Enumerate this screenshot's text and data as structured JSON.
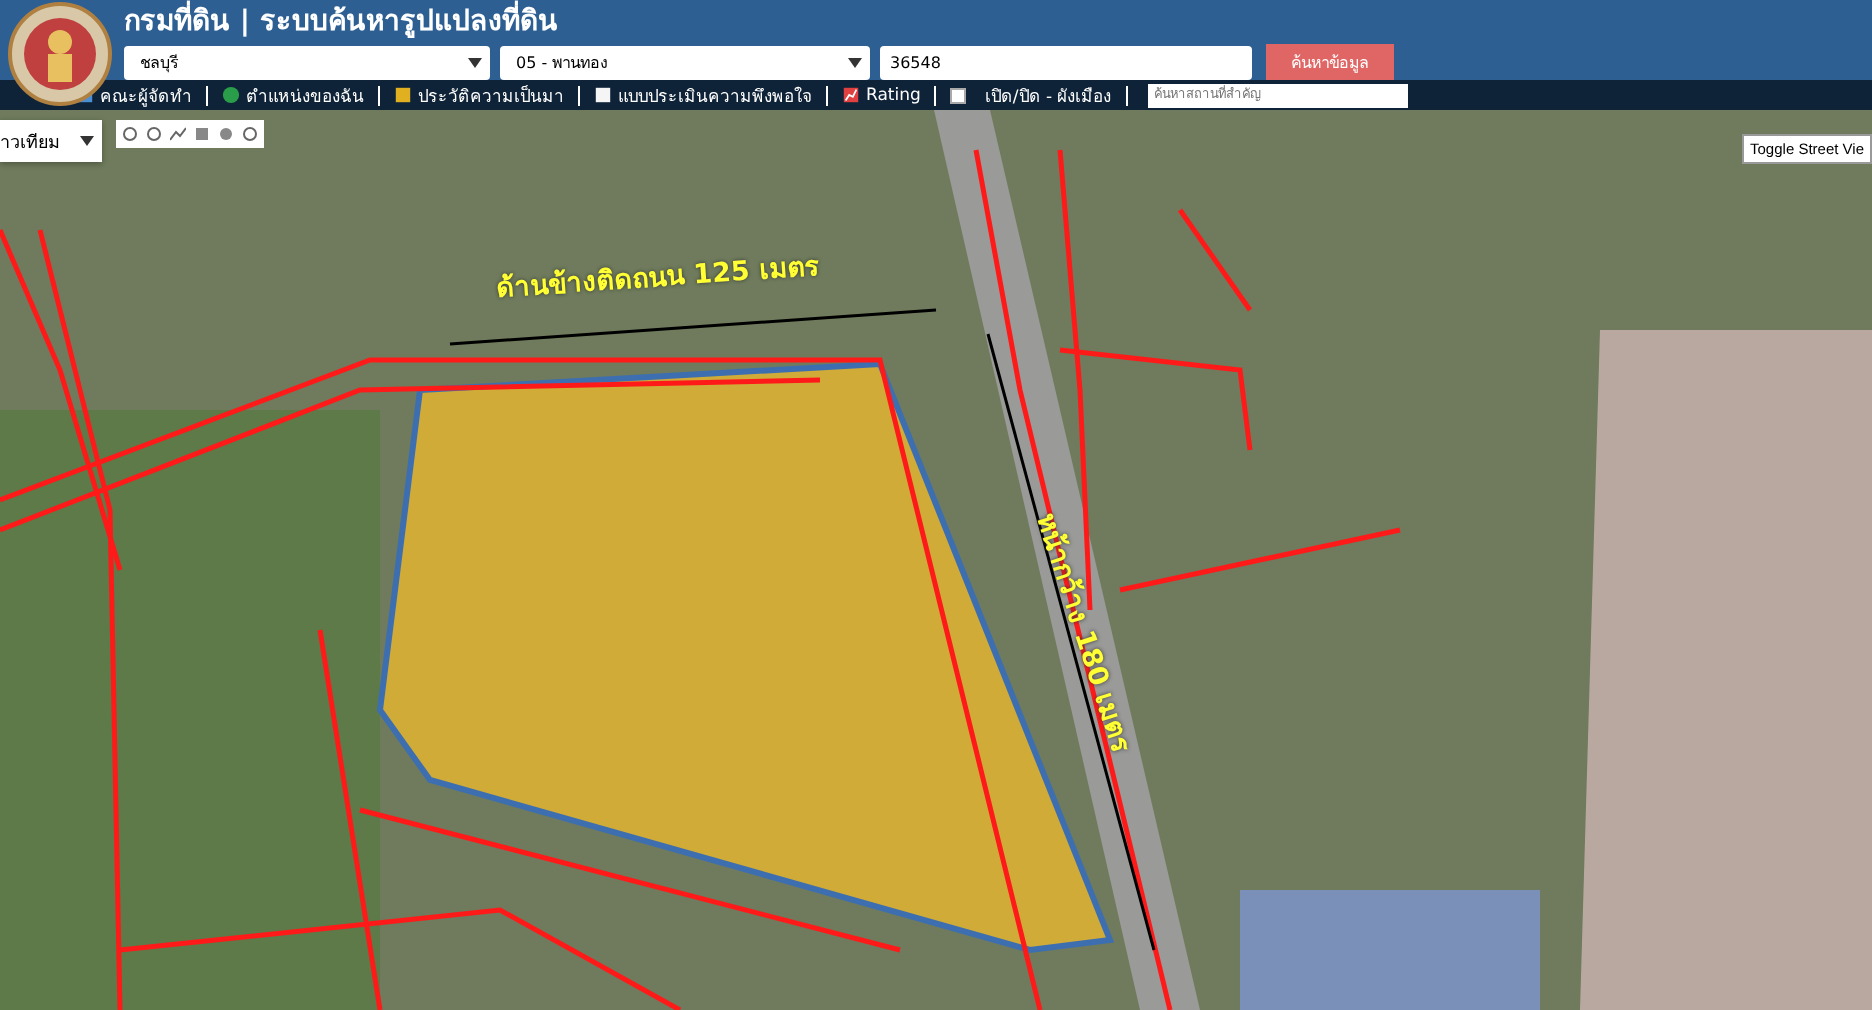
{
  "header": {
    "title": "กรมที่ดิน | ระบบค้นหารูปแปลงที่ดิน",
    "province": "ชลบุรี",
    "district": "05 - พานทอง",
    "parcel_number": "36548",
    "search_button": "ค้นหาข้อมูล"
  },
  "nav": {
    "items": [
      {
        "kind": "link",
        "label": "คณะผู้จัดทำ"
      },
      {
        "kind": "link",
        "label": "ตำแหน่งของฉัน"
      },
      {
        "kind": "link",
        "label": "ประวัติความเป็นมา"
      },
      {
        "kind": "link",
        "label": "แบบประเมินความพึงพอใจ"
      },
      {
        "kind": "link",
        "label": "Rating"
      },
      {
        "kind": "toggle",
        "label": "เปิด/ปิด - ผังเมือง",
        "checked": false
      }
    ],
    "place_search": {
      "placeholder": "ค้นหาสถานที่สำคัญ"
    }
  },
  "map": {
    "map_type": "าวเทียม",
    "street_view_button": "Toggle Street Vie",
    "side_label": "ด้านข้างติดถนน 125 เมตร",
    "front_label": "หน้ากว้าง 180 เมตร"
  }
}
